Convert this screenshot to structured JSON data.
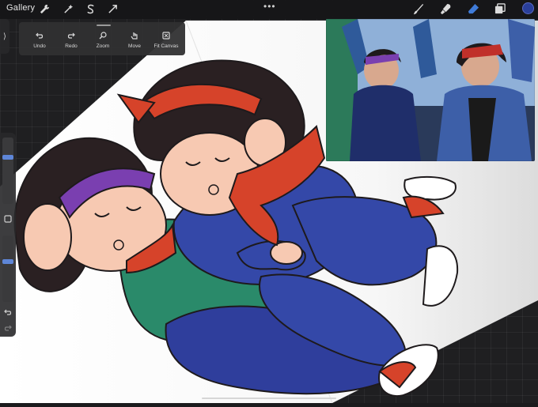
{
  "topbar": {
    "gallery_label": "Gallery",
    "left_tools": [
      "wrench-icon",
      "magic-wand-icon",
      "selection-s-icon",
      "transform-arrow-icon"
    ],
    "menu_dots": "•••",
    "right_tools": [
      "brush-icon",
      "smudge-icon",
      "eraser-icon",
      "layers-icon"
    ],
    "active_color": "#2a3f9a"
  },
  "quick_menu": {
    "items": [
      {
        "label": "Undo",
        "icon": "undo-icon"
      },
      {
        "label": "Redo",
        "icon": "redo-icon"
      },
      {
        "label": "Zoom",
        "icon": "zoom-icon"
      },
      {
        "label": "Move",
        "icon": "hand-icon"
      },
      {
        "label": "Fit Canvas",
        "icon": "fit-canvas-icon"
      }
    ]
  },
  "sidebar": {
    "brush_size": 0.72,
    "opacity": 0.62,
    "tab_glyph": "⟩"
  },
  "colors": {
    "denim": "#3448a8",
    "green": "#2a8a6a",
    "red": "#d6432a",
    "purple": "#7a3fb0",
    "skin": "#f7c9b2",
    "hair": "#2a2022"
  }
}
